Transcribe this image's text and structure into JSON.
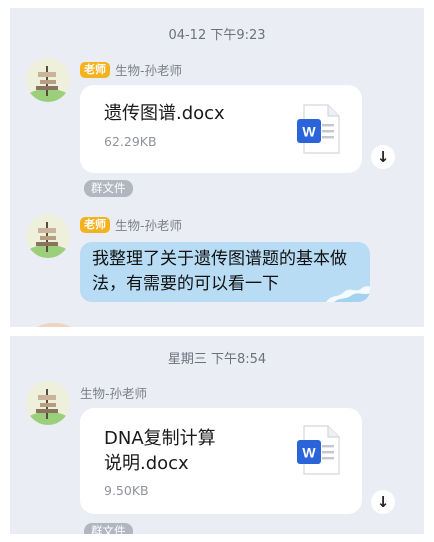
{
  "chat": {
    "block1": {
      "timestamp": "04-12 下午9:23",
      "msg1": {
        "role": "老师",
        "sender": "生物-孙老师",
        "file_name": "遗传图谱.docx",
        "file_size": "62.29KB",
        "file_tag": "群文件"
      },
      "msg2": {
        "role": "老师",
        "sender": "生物-孙老师",
        "text": "我整理了关于遗传图谱题的基本做法，有需要的可以看一下"
      }
    },
    "block2": {
      "timestamp": "星期三 下午8:54",
      "msg1": {
        "sender": "生物-孙老师",
        "file_name": "DNA复制计算\n说明.docx",
        "file_size": "9.50KB",
        "file_tag": "群文件"
      }
    }
  },
  "icons": {
    "file_type": "word-icon",
    "download": "download-icon",
    "download_glyph": "↓"
  },
  "colors": {
    "chat_background": "#ebedf5",
    "role_badge": "#f4b21f",
    "text_bubble": "#b7dcf4",
    "word_blue": "#2b63d9"
  }
}
